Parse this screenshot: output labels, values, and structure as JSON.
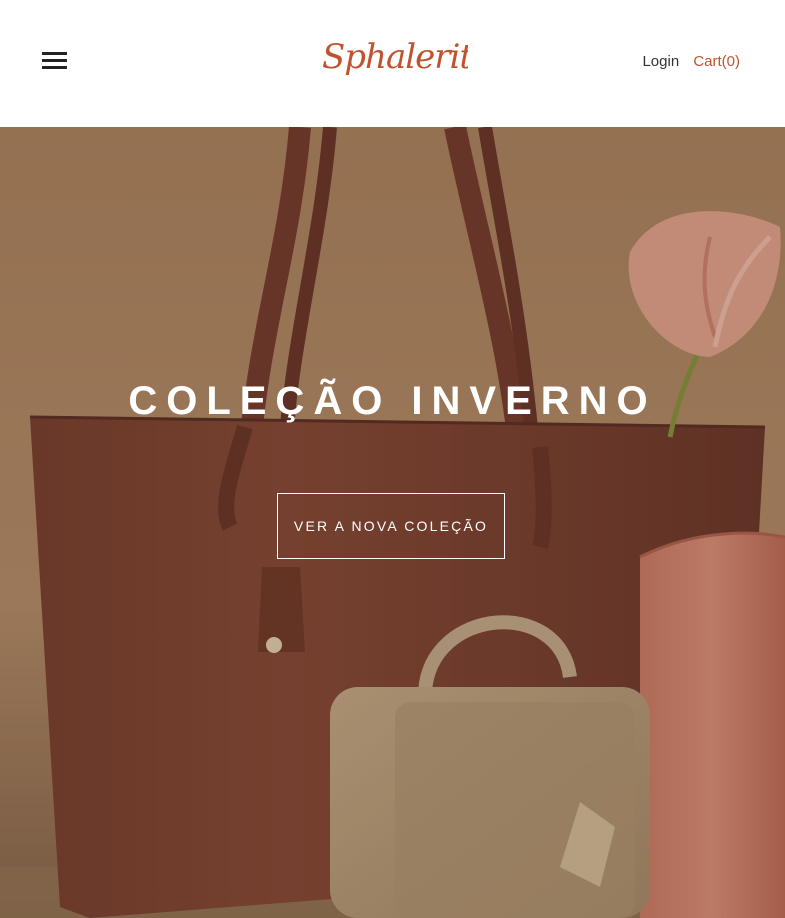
{
  "header": {
    "menu_icon": "hamburger-menu-icon",
    "brand": "Sphalerite.",
    "login_label": "Login",
    "cart_label": "Cart(0)",
    "colors": {
      "accent": "#c0532f",
      "text": "#333333"
    }
  },
  "hero": {
    "title": "COLEÇÃO INVERNO",
    "cta_label": "VER A NOVA COLEÇÃO",
    "image_description": "brown-tote-bag-beige-crossbody-pink-bag-anthurium-flower"
  }
}
